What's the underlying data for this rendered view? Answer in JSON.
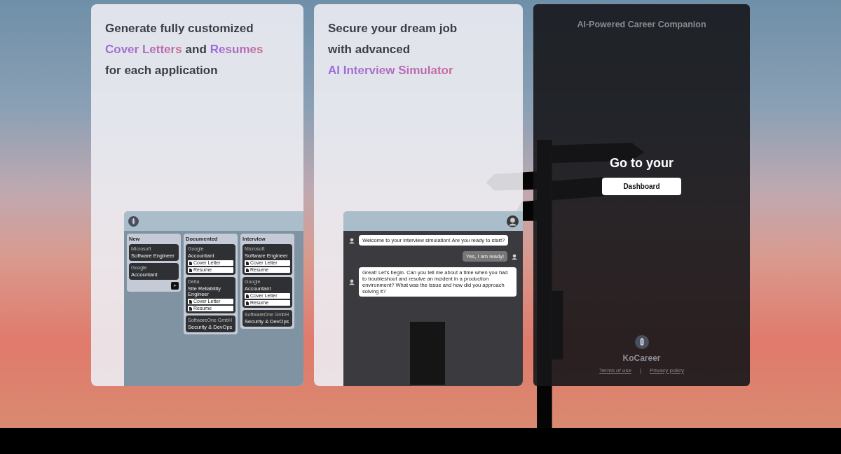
{
  "panels": [
    {
      "kind": "kanban",
      "headline": [
        [
          {
            "text": "Generate fully customized",
            "accent": false
          }
        ],
        [
          {
            "text": "Cover Letters",
            "accent": true
          },
          {
            "text": "and",
            "accent": false
          },
          {
            "text": "Resumes",
            "accent": true
          }
        ],
        [
          {
            "text": "for each application",
            "accent": false
          }
        ]
      ],
      "board": {
        "columns": [
          {
            "title": "New",
            "cards": [
              {
                "company": "Microsoft",
                "role": "Software Engineer"
              },
              {
                "company": "Google",
                "role": "Accountant"
              }
            ],
            "add_button": "+"
          },
          {
            "title": "Documented",
            "cards": [
              {
                "company": "Google",
                "role": "Accountant",
                "documents": [
                  "Cover Letter",
                  "Resume"
                ]
              },
              {
                "company": "Delta",
                "role": "Site Reliability Engineer",
                "documents": [
                  "Cover Letter",
                  "Resume"
                ]
              },
              {
                "company": "SoftwareOne GmbH",
                "role": "Security & DevOps"
              }
            ]
          },
          {
            "title": "Interview",
            "cards": [
              {
                "company": "Microsoft",
                "role": "Software Engineer",
                "documents": [
                  "Cover Letter",
                  "Resume"
                ]
              },
              {
                "company": "Google",
                "role": "Accountant",
                "documents": [
                  "Cover Letter",
                  "Resume"
                ]
              },
              {
                "company": "SoftwareOne GmbH",
                "role": "Security & DevOps"
              }
            ]
          }
        ]
      }
    },
    {
      "kind": "chat",
      "headline": [
        [
          {
            "text": "Secure your dream job",
            "accent": false
          }
        ],
        [
          {
            "text": "with advanced",
            "accent": false
          }
        ],
        [
          {
            "text": "AI Interview Simulator",
            "accent": true
          }
        ]
      ],
      "messages": [
        {
          "kind": "bot",
          "text": "Welcome to your interview simulation! Are you ready to start?"
        },
        {
          "kind": "user",
          "text": "Yes, I am ready!"
        },
        {
          "kind": "bot",
          "text": "Great! Let's begin. Can you tell me about a time when you had to troubleshoot and resolve an incident in a production environment? What was the issue and how did you approach solving it?"
        }
      ]
    }
  ],
  "login": {
    "tagline": "AI-Powered Career Companion",
    "heading": "Go to your",
    "button": "Dashboard",
    "brand": "KoCareer",
    "links": [
      "Terms of use",
      "Privacy policy"
    ],
    "separator": "|"
  }
}
